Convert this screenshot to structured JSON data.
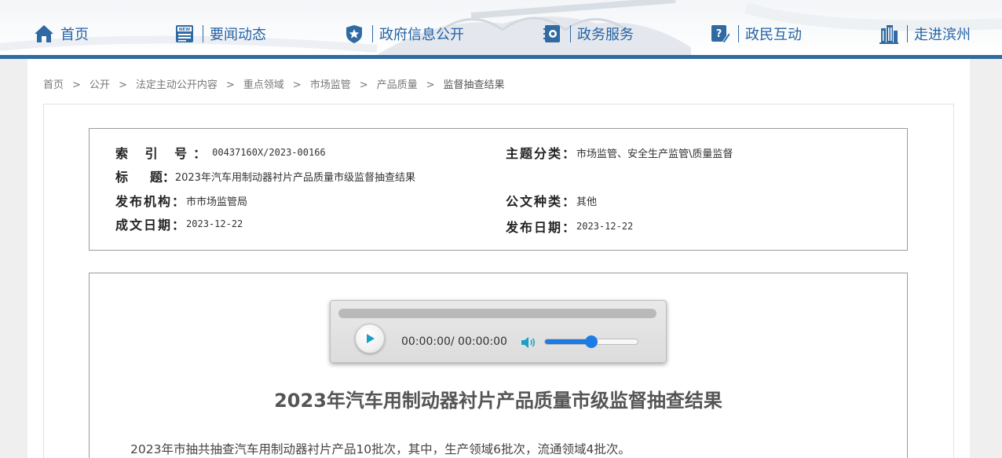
{
  "nav": {
    "items": [
      {
        "label": "首页",
        "icon": "home-icon"
      },
      {
        "label": "要闻动态",
        "icon": "news-icon"
      },
      {
        "label": "政府信息公开",
        "icon": "badge-icon"
      },
      {
        "label": "政务服务",
        "icon": "service-book-icon"
      },
      {
        "label": "政民互动",
        "icon": "edit-icon"
      },
      {
        "label": "走进滨州",
        "icon": "building-icon"
      }
    ],
    "accent_color": "#2f6aa3",
    "text_color": "#2563a4"
  },
  "breadcrumb": {
    "items": [
      "首页",
      "公开",
      "法定主动公开内容",
      "重点领域",
      "市场监管",
      "产品质量",
      "监督抽查结果"
    ],
    "separator": ">"
  },
  "meta": {
    "index_label": "索 引 号：",
    "index_value": "00437160X/2023-00166",
    "topic_label": "主题分类：",
    "topic_value": "市场监管、安全生产监管\\质量监督",
    "title_label": "标     题：",
    "title_value": "2023年汽车用制动器衬片产品质量市级监督抽查结果",
    "org_label": "发布机构：",
    "org_value": "市市场监管局",
    "doctype_label": "公文种类：",
    "doctype_value": "其他",
    "written_label": "成文日期：",
    "written_value": "2023-12-22",
    "publish_label": "发布日期：",
    "publish_value": "2023-12-22"
  },
  "player": {
    "time": "00:00:00/ 00:00:00",
    "progress": 0,
    "volume": 0.5,
    "play_icon": "play-icon",
    "volume_icon": "speaker-icon"
  },
  "article": {
    "title": "2023年汽车用制动器衬片产品质量市级监督抽查结果",
    "paragraph": "2023年市抽共抽查汽车用制动器衬片产品10批次，其中，生产领域6批次，流通领域4批次。"
  }
}
